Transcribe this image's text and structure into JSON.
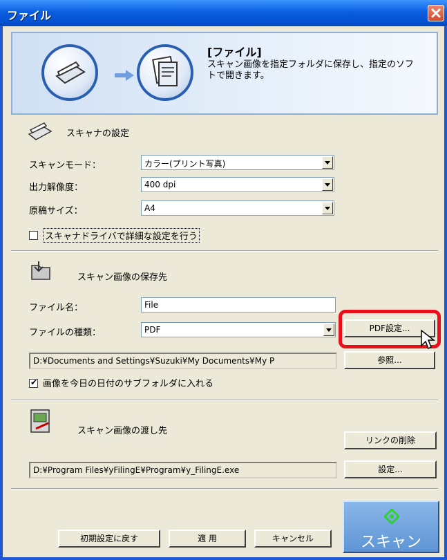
{
  "window": {
    "title": "ファイル"
  },
  "banner": {
    "heading": "[ファイル]",
    "description": "スキャン画像を指定フォルダに保存し、指定のソフトで開きます。"
  },
  "scanner_settings": {
    "title": "スキャナの設定",
    "scan_mode": {
      "label": "スキャンモード：",
      "value": "カラー(プリント写真)"
    },
    "resolution": {
      "label": "出力解像度：",
      "value": "400 dpi"
    },
    "doc_size": {
      "label": "原稿サイズ：",
      "value": "A4"
    },
    "driver_checkbox": {
      "label": "スキャナドライバで詳細な設定を行う",
      "checked": false
    }
  },
  "save_dest": {
    "title": "スキャン画像の保存先",
    "filename": {
      "label": "ファイル名：",
      "value": "File"
    },
    "filetype": {
      "label": "ファイルの種類：",
      "value": "PDF"
    },
    "pdf_settings_button": "PDF設定...",
    "path": "D:¥Documents and Settings¥Suzuki¥My Documents¥My P",
    "browse_button": "参照...",
    "subfolder_checkbox": {
      "label": "画像を今日の日付のサブフォルダに入れる",
      "checked": true
    }
  },
  "handoff": {
    "title": "スキャン画像の渡し先",
    "remove_link_button": "リンクの削除",
    "app_path": "D:¥Program Files¥yFilingE¥Program¥y_FilingE.exe",
    "settings_button": "設定..."
  },
  "footer": {
    "reset_button": "初期設定に戻す",
    "apply_button": "適 用",
    "cancel_button": "キャンセル",
    "scan_button": "スキャン"
  },
  "colors": {
    "highlight": "#e8101a",
    "titlebar": "#0a5fe0",
    "scan_button": "#5e95d6"
  }
}
